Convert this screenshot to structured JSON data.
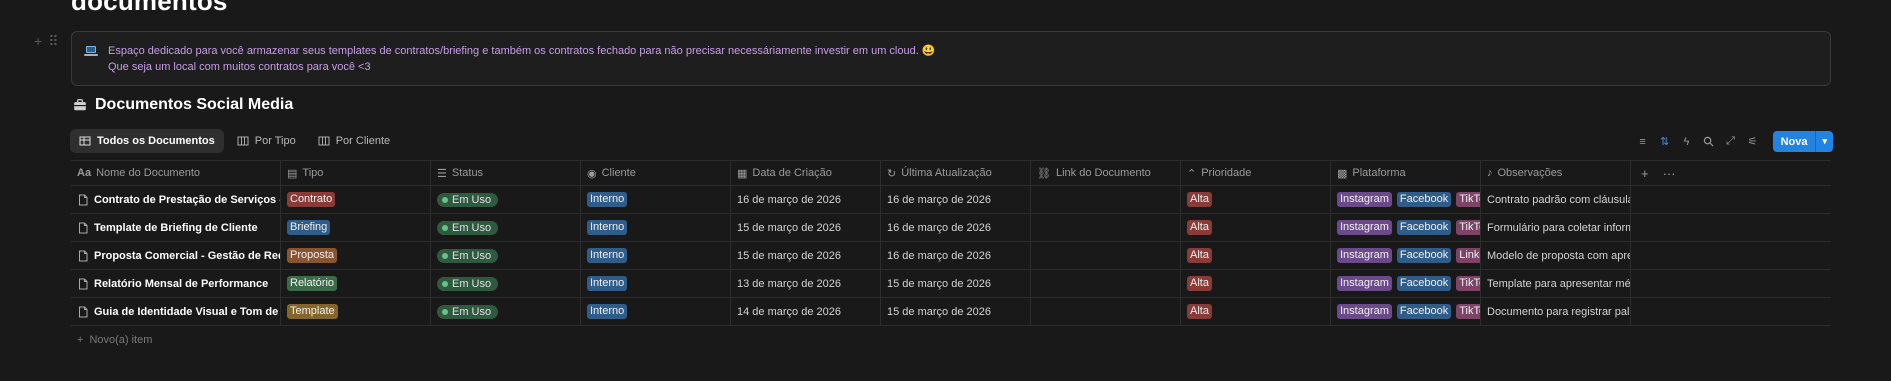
{
  "page": {
    "title": "documentos",
    "callout": {
      "icon": "laptop-icon",
      "line1": "Espaço dedicado para você armazenar seus templates de contratos/briefing e também os contratos fechado para não precisar necessáriamente investir em um cloud. 😃",
      "line2": "Que seja um local com muitos contratos para você <3"
    }
  },
  "database": {
    "title": "Documentos Social Media",
    "icon": "briefcase-icon",
    "views": [
      {
        "label": "Todos os Documentos",
        "icon": "table-icon",
        "active": true
      },
      {
        "label": "Por Tipo",
        "icon": "board-icon",
        "active": false
      },
      {
        "label": "Por Cliente",
        "icon": "board-icon",
        "active": false
      }
    ],
    "toolbar": {
      "icons": [
        "filter-icon",
        "sort-icon",
        "lightning-icon",
        "search-icon",
        "expand-icon",
        "settings-icon"
      ],
      "new_label": "Nova"
    },
    "columns": [
      {
        "label": "Nome do Documento",
        "icon": "text-icon"
      },
      {
        "label": "Tipo",
        "icon": "tag-icon"
      },
      {
        "label": "Status",
        "icon": "status-icon"
      },
      {
        "label": "Cliente",
        "icon": "person-icon"
      },
      {
        "label": "Data de Criação",
        "icon": "calendar-icon"
      },
      {
        "label": "Última Atualização",
        "icon": "clock-icon"
      },
      {
        "label": "Link do Documento",
        "icon": "link-icon"
      },
      {
        "label": "Prioridade",
        "icon": "priority-icon"
      },
      {
        "label": "Plataforma",
        "icon": "multiselect-icon"
      },
      {
        "label": "Observações",
        "icon": "note-icon"
      }
    ],
    "header_extras": [
      "+",
      "···"
    ],
    "rows": [
      {
        "name": "Contrato de Prestação de Serviços - Social Media",
        "tipo": "Contrato",
        "tipo_color": "red",
        "status": "Em Uso",
        "cliente": "Interno",
        "criacao": "16 de março de 2026",
        "atualizacao": "16 de março de 2026",
        "link": "",
        "prioridade": "Alta",
        "plataformas": [
          "Instagram",
          "Facebook",
          "TikTok"
        ],
        "obs": "Contrato padrão com cláusulas"
      },
      {
        "name": "Template de Briefing de Cliente",
        "tipo": "Briefing",
        "tipo_color": "blue",
        "status": "Em Uso",
        "cliente": "Interno",
        "criacao": "15 de março de 2026",
        "atualizacao": "16 de março de 2026",
        "link": "",
        "prioridade": "Alta",
        "plataformas": [
          "Instagram",
          "Facebook",
          "TikTok"
        ],
        "obs": "Formulário para coletar informações"
      },
      {
        "name": "Proposta Comercial - Gestão de Redes Sociais",
        "tipo": "Proposta",
        "tipo_color": "orange",
        "status": "Em Uso",
        "cliente": "Interno",
        "criacao": "15 de março de 2026",
        "atualizacao": "16 de março de 2026",
        "link": "",
        "prioridade": "Alta",
        "plataformas": [
          "Instagram",
          "Facebook",
          "LinkedIn"
        ],
        "obs": "Modelo de proposta com apresentação"
      },
      {
        "name": "Relatório Mensal de Performance",
        "tipo": "Relatório",
        "tipo_color": "green",
        "status": "Em Uso",
        "cliente": "Interno",
        "criacao": "13 de março de 2026",
        "atualizacao": "15 de março de 2026",
        "link": "",
        "prioridade": "Alta",
        "plataformas": [
          "Instagram",
          "Facebook",
          "TikTok"
        ],
        "obs": "Template para apresentar métricas"
      },
      {
        "name": "Guia de Identidade Visual e Tom de Voz",
        "tipo": "Template",
        "tipo_color": "yellow",
        "status": "Em Uso",
        "cliente": "Interno",
        "criacao": "14 de março de 2026",
        "atualizacao": "15 de março de 2026",
        "link": "",
        "prioridade": "Alta",
        "plataformas": [
          "Instagram",
          "Facebook",
          "TikTok"
        ],
        "obs": "Documento para registrar paleta"
      }
    ],
    "add_row_label": "Novo(a) item"
  },
  "colors": {
    "background": "#191919",
    "accent": "#2383e2",
    "callout_text": "#c79ee8",
    "status_dot": "#6ac28a"
  }
}
